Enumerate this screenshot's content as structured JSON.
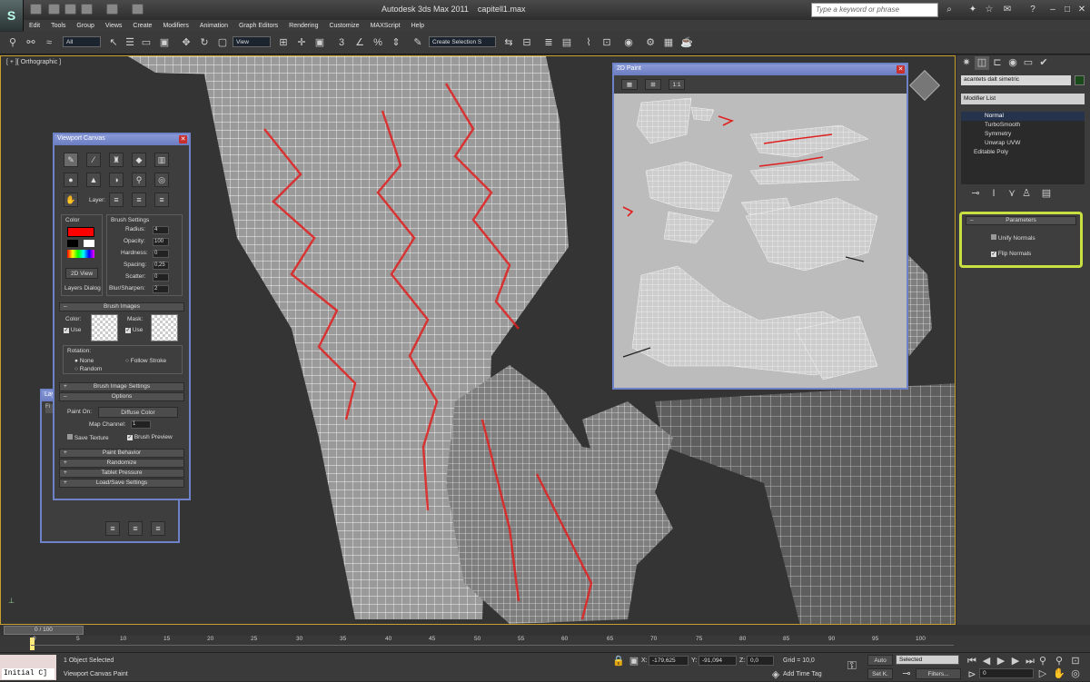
{
  "app": {
    "title": "Autodesk 3ds Max  2011",
    "file": "capitell1.max",
    "logo_label": "S"
  },
  "search": {
    "placeholder": "Type a keyword or phrase"
  },
  "menu": [
    "Edit",
    "Tools",
    "Group",
    "Views",
    "Create",
    "Modifiers",
    "Animation",
    "Graph Editors",
    "Rendering",
    "Customize",
    "MAXScript",
    "Help"
  ],
  "toolbar": {
    "filter": "All",
    "ref_coord": "View",
    "selection_set": "Create Selection S",
    "snap_label": "3"
  },
  "viewport": {
    "label": "[ + ][ Orthographic ]"
  },
  "canvas_panel": {
    "title": "Viewport Canvas",
    "layer_label": "Layer:",
    "color_group": "Color",
    "brush_settings": "Brush Settings",
    "radius_label": "Radius:",
    "radius": "4",
    "opacity_label": "Opacity:",
    "opacity": "100",
    "hardness_label": "Hardness:",
    "hardness": "0",
    "spacing_label": "Spacing:",
    "spacing": "0,25",
    "scatter_label": "Scatter:",
    "scatter": "0",
    "blur_label": "Blur/Sharpen:",
    "blur": "2",
    "view2d": "2D View",
    "layers_dialog": "Layers Dialog",
    "brush_images": "Brush Images",
    "color_label": "Color:",
    "mask_label": "Mask:",
    "use": "Use",
    "rotation": "Rotation:",
    "none": "None",
    "follow": "Follow Stroke",
    "random": "Random",
    "brush_image_settings": "Brush Image Settings",
    "options": "Options",
    "paint_on": "Paint On:",
    "paint_on_value": "Diffuse Color",
    "map_channel": "Map Channel:",
    "map_channel_value": "1",
    "save_texture": "Save Texture",
    "brush_preview": "Brush Preview",
    "paint_behavior": "Paint Behavior",
    "randomize": "Randomize",
    "tablet": "Tablet Pressure",
    "load_save": "Load/Save Settings"
  },
  "layers_panel": {
    "title": "Lay",
    "tab": "Fi"
  },
  "paint2d": {
    "title": "2D Paint",
    "btn_ratio": "1:1"
  },
  "cmd": {
    "object_name": "acantets dalt simetric",
    "modifier_list": "Modifier List",
    "stack": [
      "Normal",
      "TurboSmooth",
      "Symmetry",
      "Unwrap UVW",
      "Editable Poly"
    ],
    "parameters": "Parameters",
    "unify": "Unify Normals",
    "flip": "Flip Normals"
  },
  "timeline": {
    "frame": "0 / 100",
    "ticks": [
      "0",
      "5",
      "10",
      "15",
      "20",
      "25",
      "30",
      "35",
      "40",
      "45",
      "50",
      "55",
      "60",
      "65",
      "70",
      "75",
      "80",
      "85",
      "90",
      "95",
      "100"
    ]
  },
  "status": {
    "initial": "Initial C]",
    "selected_msg": "1 Object Selected",
    "prompt": "Viewport Canvas Paint",
    "x_label": "X:",
    "x": "-179,625",
    "y_label": "Y:",
    "y": "-91,094",
    "z_label": "Z:",
    "z": "0,0",
    "grid": "Grid = 10,0",
    "add_time_tag": "Add Time Tag",
    "auto": "Auto",
    "setk": "Set K.",
    "selected": "Selected",
    "filters": "Filters...",
    "frame_field": "0"
  },
  "colors": {
    "accent": "#c8e040",
    "panel_border": "#6e82c8",
    "paint_red": "#e02020"
  }
}
